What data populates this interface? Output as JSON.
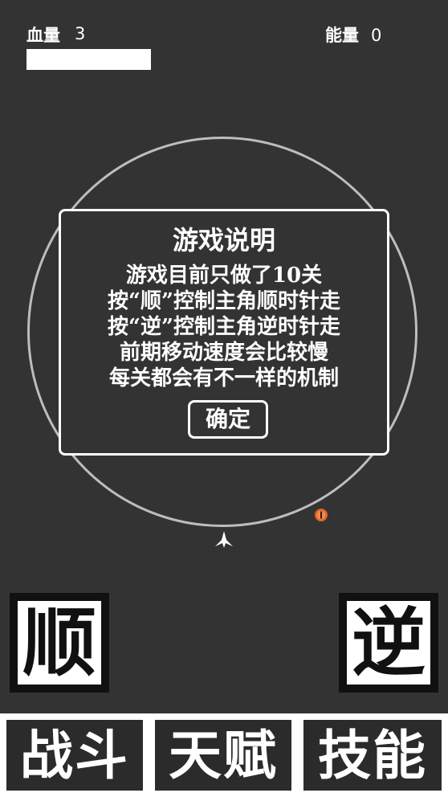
{
  "hud": {
    "hp_label": "血量",
    "hp_value": "3",
    "energy_label": "能量",
    "energy_value": "0",
    "hp_fill_fraction": 1.0
  },
  "dialog": {
    "title": "游戏说明",
    "lines": [
      "游戏目前只做了10关",
      "按“顺”控制主角顺时针走",
      "按“逆”控制主角逆时针走",
      "前期移动速度会比较慢",
      "每关都会有不一样的机制"
    ],
    "confirm_label": "确定"
  },
  "controls": {
    "clockwise_label": "顺",
    "counterclockwise_label": "逆"
  },
  "nav": {
    "tabs": [
      "战斗",
      "天赋",
      "技能"
    ]
  },
  "colors": {
    "background": "#333333",
    "ring": "#bdbdbd",
    "orb": "#e0622a",
    "text": "#ffffff"
  },
  "icons": {
    "player": "player-sprite-icon",
    "orb": "energy-orb-icon"
  }
}
